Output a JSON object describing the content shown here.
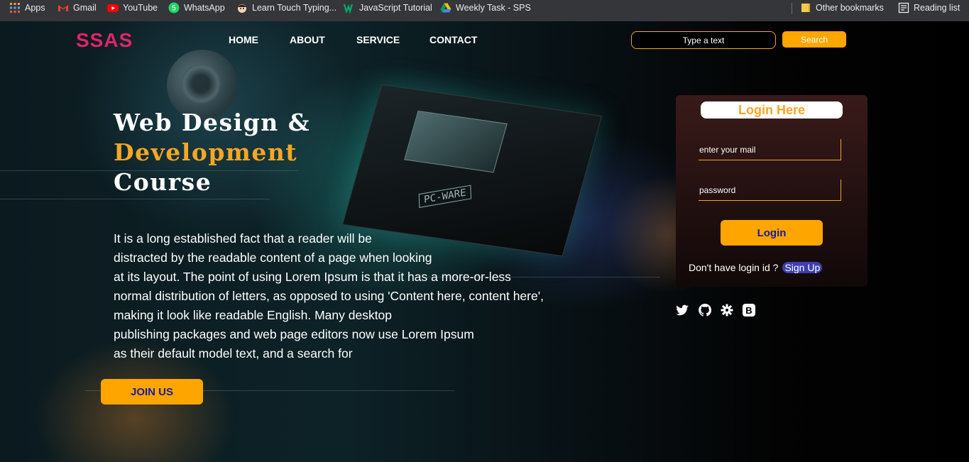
{
  "bookmarks": {
    "items": [
      {
        "label": "Apps",
        "icon": "apps-grid-icon"
      },
      {
        "label": "Gmail",
        "icon": "gmail-icon"
      },
      {
        "label": "YouTube",
        "icon": "youtube-icon"
      },
      {
        "label": "WhatsApp",
        "icon": "whatsapp-icon"
      },
      {
        "label": "Learn Touch Typing...",
        "icon": "typing-icon"
      },
      {
        "label": "JavaScript Tutorial",
        "icon": "w3schools-icon"
      },
      {
        "label": "Weekly Task - SPS",
        "icon": "google-drive-icon"
      }
    ],
    "other": "Other bookmarks",
    "reading": "Reading list"
  },
  "nav": {
    "logo": "SSAS",
    "links": [
      "HOME",
      "ABOUT",
      "SERVICE",
      "CONTACT"
    ],
    "search_placeholder": "Type a text",
    "search_button": "Search"
  },
  "hero": {
    "line1": "Web Design &",
    "line2": "Development",
    "line3": "Course",
    "paragraph": [
      "It is a long established fact that a reader will be",
      "distracted by the readable content of a page when looking",
      "at its layout. The point of using Lorem Ipsum is that it has a more-or-less",
      "normal distribution of letters, as opposed to using 'Content here, content here',",
      "making it look like readable English. Many desktop",
      "publishing packages and web page editors now use Lorem Ipsum",
      "as their default model text, and a search for"
    ],
    "join_button": "JOIN US",
    "chip_label": "PC-WARE"
  },
  "login": {
    "title": "Login Here",
    "email_placeholder": "enter your mail",
    "password_placeholder": "password",
    "button": "Login",
    "no_account": "Don't have login id ?",
    "signup": "Sign Up"
  },
  "social_icons": [
    "twitter-icon",
    "github-icon",
    "gear-icon",
    "bootstrap-icon"
  ],
  "colors": {
    "accent": "#ffa500",
    "logo": "#e0246a",
    "button_text": "#1b1b9a"
  }
}
